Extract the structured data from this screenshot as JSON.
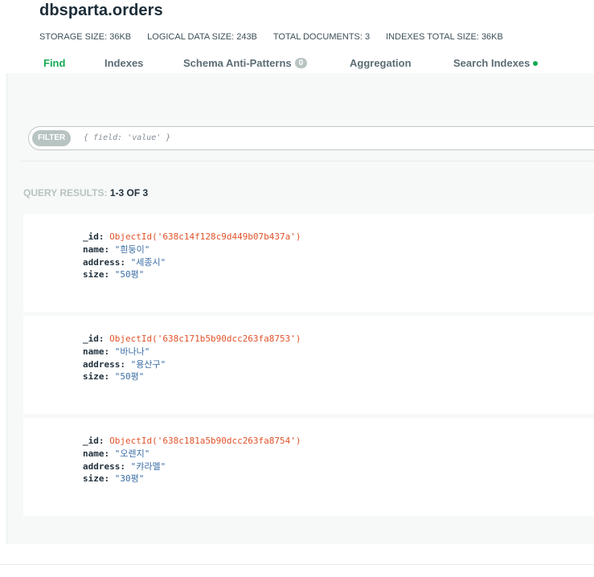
{
  "collection": {
    "title": "dbsparta.orders"
  },
  "stats": [
    {
      "label": "STORAGE SIZE:",
      "value": "36KB"
    },
    {
      "label": "LOGICAL DATA SIZE:",
      "value": "243B"
    },
    {
      "label": "TOTAL DOCUMENTS:",
      "value": "3"
    },
    {
      "label": "INDEXES TOTAL SIZE:",
      "value": "36KB"
    }
  ],
  "tabs": {
    "find": "Find",
    "indexes": "Indexes",
    "schema": "Schema Anti-Patterns",
    "schema_badge": "0",
    "aggregation": "Aggregation",
    "search_indexes": "Search Indexes"
  },
  "filter": {
    "label": "FILTER",
    "placeholder": "{ field: 'value' }"
  },
  "results": {
    "label": "QUERY RESULTS:",
    "count": "1-3 OF 3"
  },
  "documents": [
    {
      "id": "ObjectId('638c14f128c9d449b07b437a')",
      "name": "\"흰둥이\"",
      "address": "\"세종시\"",
      "size": "\"50평\""
    },
    {
      "id": "ObjectId('638c171b5b90dcc263fa8753')",
      "name": "\"바나나\"",
      "address": "\"용산구\"",
      "size": "\"50평\""
    },
    {
      "id": "ObjectId('638c181a5b90dcc263fa8754')",
      "name": "\"오렌지\"",
      "address": "\"캬라멜\"",
      "size": "\"30평\""
    }
  ],
  "field_keys": {
    "id": "_id:",
    "name": "name:",
    "address": "address:",
    "size": "size:"
  },
  "colors": {
    "accent": "#13aa52",
    "object_id": "#e0532a",
    "string": "#3b6ea5"
  }
}
